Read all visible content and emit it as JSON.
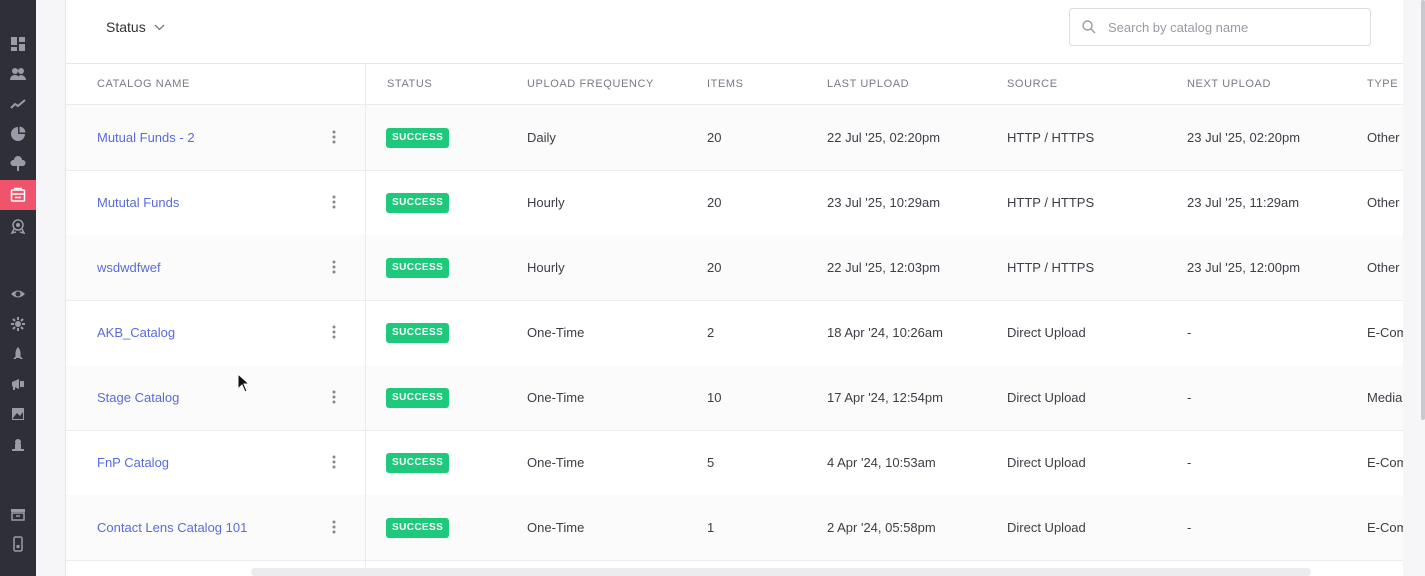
{
  "sidebar": {
    "icons": [
      {
        "name": "dashboard-icon"
      },
      {
        "name": "users-icon"
      },
      {
        "name": "trends-icon"
      },
      {
        "name": "pie-chart-icon"
      },
      {
        "name": "cloud-upload-icon"
      },
      {
        "name": "catalog-icon",
        "active": true
      },
      {
        "name": "badge-icon"
      },
      {
        "name": "eye-icon"
      },
      {
        "name": "settings-icon"
      },
      {
        "name": "rocket-icon"
      },
      {
        "name": "megaphone-icon"
      },
      {
        "name": "image-icon"
      },
      {
        "name": "plugin-icon"
      },
      {
        "name": "archive-icon"
      },
      {
        "name": "mobile-icon"
      }
    ]
  },
  "toolbar": {
    "status_filter_label": "Status",
    "search_placeholder": "Search by catalog name"
  },
  "table": {
    "headers": {
      "name": "CATALOG NAME",
      "status": "STATUS",
      "frequency": "UPLOAD FREQUENCY",
      "items": "ITEMS",
      "last_upload": "LAST UPLOAD",
      "source": "SOURCE",
      "next_upload": "NEXT UPLOAD",
      "type": "TYPE"
    },
    "rows": [
      {
        "name": "Mutual Funds - 2",
        "status": "SUCCESS",
        "frequency": "Daily",
        "items": "20",
        "last_upload": "22 Jul '25, 02:20pm",
        "source": "HTTP / HTTPS",
        "next_upload": "23 Jul '25, 02:20pm",
        "type": "Other"
      },
      {
        "name": "Mututal Funds",
        "status": "SUCCESS",
        "frequency": "Hourly",
        "items": "20",
        "last_upload": "23 Jul '25, 10:29am",
        "source": "HTTP / HTTPS",
        "next_upload": "23 Jul '25, 11:29am",
        "type": "Other"
      },
      {
        "name": "wsdwdfwef",
        "status": "SUCCESS",
        "frequency": "Hourly",
        "items": "20",
        "last_upload": "22 Jul '25, 12:03pm",
        "source": "HTTP / HTTPS",
        "next_upload": "23 Jul '25, 12:00pm",
        "type": "Other"
      },
      {
        "name": "AKB_Catalog",
        "status": "SUCCESS",
        "frequency": "One-Time",
        "items": "2",
        "last_upload": "18 Apr '24, 10:26am",
        "source": "Direct Upload",
        "next_upload": "-",
        "type": "E-Com"
      },
      {
        "name": "Stage Catalog",
        "status": "SUCCESS",
        "frequency": "One-Time",
        "items": "10",
        "last_upload": "17 Apr '24, 12:54pm",
        "source": "Direct Upload",
        "next_upload": "-",
        "type": "Media"
      },
      {
        "name": "FnP Catalog",
        "status": "SUCCESS",
        "frequency": "One-Time",
        "items": "5",
        "last_upload": "4 Apr '24, 10:53am",
        "source": "Direct Upload",
        "next_upload": "-",
        "type": "E-Com"
      },
      {
        "name": "Contact Lens Catalog 101",
        "status": "SUCCESS",
        "frequency": "One-Time",
        "items": "1",
        "last_upload": "2 Apr '24, 05:58pm",
        "source": "Direct Upload",
        "next_upload": "-",
        "type": "E-Com"
      }
    ]
  },
  "colors": {
    "sidebar_bg": "#2e2f37",
    "active_accent": "#f0546c",
    "success_badge": "#1ec97b",
    "link": "#5a6bd8"
  }
}
